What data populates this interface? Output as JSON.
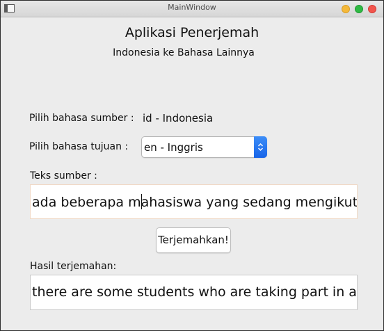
{
  "window": {
    "title": "MainWindow"
  },
  "header": {
    "title": "Aplikasi Penerjemah",
    "subtitle": "Indonesia ke Bahasa Lainnya"
  },
  "form": {
    "source_lang_label": "Pilih bahasa sumber :",
    "source_lang_value": "id - Indonesia",
    "target_lang_label": "Pilih bahasa tujuan :",
    "target_lang_selected": "en - Inggris",
    "source_text_label": "Teks sumber :",
    "source_text_before_caret": "ada beberapa m",
    "source_text_after_caret": "ahasiswa yang sedang mengikuti pro",
    "translate_button": "Terjemahkan!",
    "result_label": "Hasil terjemahan:",
    "result_text": "there are some students who are taking part in an in"
  },
  "icons": {
    "window_icon": "window-icon",
    "combo_arrow": "updown-chevron-icon"
  },
  "colors": {
    "accent": "#1f6ef0",
    "close": "#f2544c",
    "minimize": "#f5b93a",
    "maximize": "#2eb943"
  }
}
